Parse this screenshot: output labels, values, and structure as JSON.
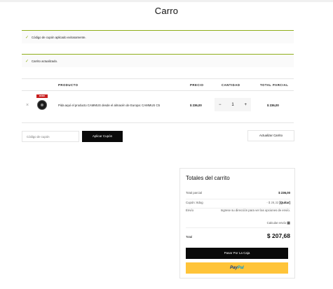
{
  "page": {
    "title": "Carro"
  },
  "notices": [
    {
      "icon": "check-icon",
      "text": "Código de cupón aplicado exitosamente."
    },
    {
      "icon": "check-icon",
      "text": "Carrito actualizado."
    }
  ],
  "cart_table": {
    "headers": {
      "product": "PRODUCTO",
      "price": "PRECIO",
      "quantity": "CANTIDAD",
      "subtotal": "TOTAL PARCIAL"
    },
    "items": [
      {
        "remove": "×",
        "thumbnail_badge": "MOMO",
        "name": "Pida aquí el producto CAMMUS desde el almacén de Europa: CAMMUS C5",
        "price": "$ 236,00",
        "qty_minus": "−",
        "quantity": "1",
        "qty_plus": "+",
        "subtotal": "$ 236,00"
      }
    ]
  },
  "coupon": {
    "placeholder": "Código de cupón",
    "apply_label": "Aplicar Cupón"
  },
  "update_cart_label": "Actualizar Carrito",
  "totals": {
    "title": "Totales del carrito",
    "subtotal_label": "Total parcial",
    "subtotal_value": "$ 236,00",
    "coupon_label": "Cupón: 8dog",
    "coupon_value": "- $ 28,32",
    "coupon_remove": "[Quitar]",
    "shipping_label": "Envío",
    "shipping_text": "Ingrese su dirección para ver las opciones de envío.",
    "calc_shipping": "Calcular envío",
    "total_label": "Total",
    "total_value": "$ 207,68",
    "checkout_label": "Pasar Por La Caja",
    "paypal_a": "Pay",
    "paypal_b": "Pal"
  },
  "colors": {
    "notice_accent": "#8fae1b",
    "dark_button": "#0a0a0a",
    "paypal_yellow": "#ffc439"
  }
}
